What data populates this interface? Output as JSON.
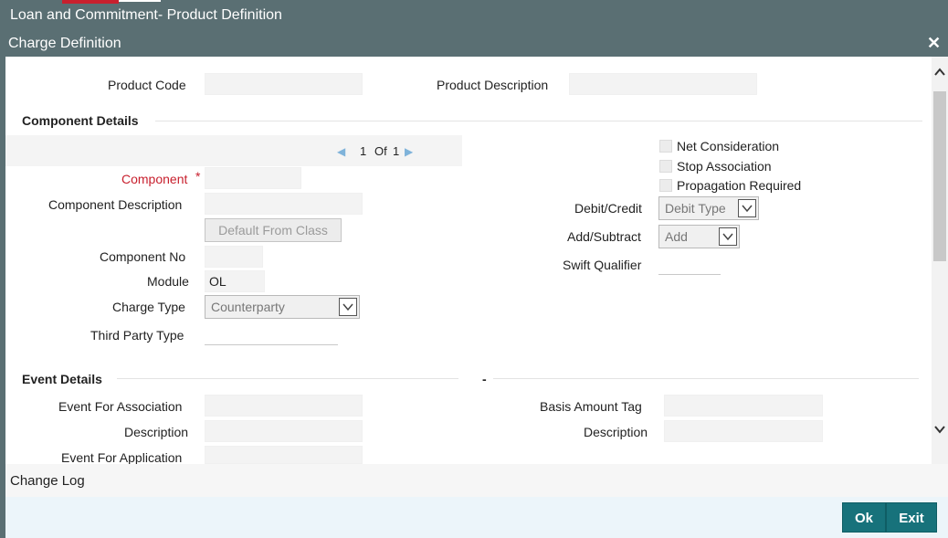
{
  "window": {
    "outer_title": "Loan and Commitment- Product Definition",
    "dialog_title": "Charge Definition",
    "close_glyph": "✕"
  },
  "header_fields": {
    "product_code_label": "Product Code",
    "product_code_value": "",
    "product_description_label": "Product Description",
    "product_description_value": ""
  },
  "component_details": {
    "section_title": "Component Details",
    "pager": {
      "current": "1",
      "of_label": "Of",
      "total": "1"
    },
    "component_label": "Component",
    "component_required_mark": "*",
    "component_value": "",
    "component_description_label": "Component Description",
    "component_description_value": "",
    "default_from_class_label": "Default From Class",
    "component_no_label": "Component No",
    "component_no_value": "",
    "module_label": "Module",
    "module_value": "OL",
    "charge_type_label": "Charge Type",
    "charge_type_value": "Counterparty",
    "third_party_type_label": "Third Party Type",
    "third_party_type_value": "",
    "net_consideration_label": "Net Consideration",
    "net_consideration_checked": false,
    "stop_association_label": "Stop Association",
    "stop_association_checked": false,
    "propagation_required_label": "Propagation Required",
    "propagation_required_checked": false,
    "debit_credit_label": "Debit/Credit",
    "debit_credit_value": "Debit Type",
    "add_subtract_label": "Add/Subtract",
    "add_subtract_value": "Add",
    "swift_qualifier_label": "Swift Qualifier",
    "swift_qualifier_value": ""
  },
  "event_details": {
    "section_title": "Event Details",
    "right_section_title": "-",
    "event_for_association_label": "Event For Association",
    "event_for_association_value": "",
    "description_label_left": "Description",
    "description_value_left": "",
    "event_for_application_label": "Event For Application",
    "basis_amount_tag_label": "Basis Amount Tag",
    "basis_amount_tag_value": "",
    "description_label_right": "Description",
    "description_value_right": ""
  },
  "footer": {
    "change_log_label": "Change Log",
    "ok_label": "Ok",
    "exit_label": "Exit"
  },
  "colors": {
    "title_bar": "#5a6f73",
    "accent_red": "#c8202e",
    "button_teal": "#17727b"
  },
  "icons": {
    "close": "close-icon",
    "scroll_up": "chevron-up-icon",
    "scroll_down": "chevron-down-icon",
    "pager_prev": "triangle-left-icon",
    "pager_next": "triangle-right-icon",
    "dropdown": "chevron-down-icon"
  }
}
